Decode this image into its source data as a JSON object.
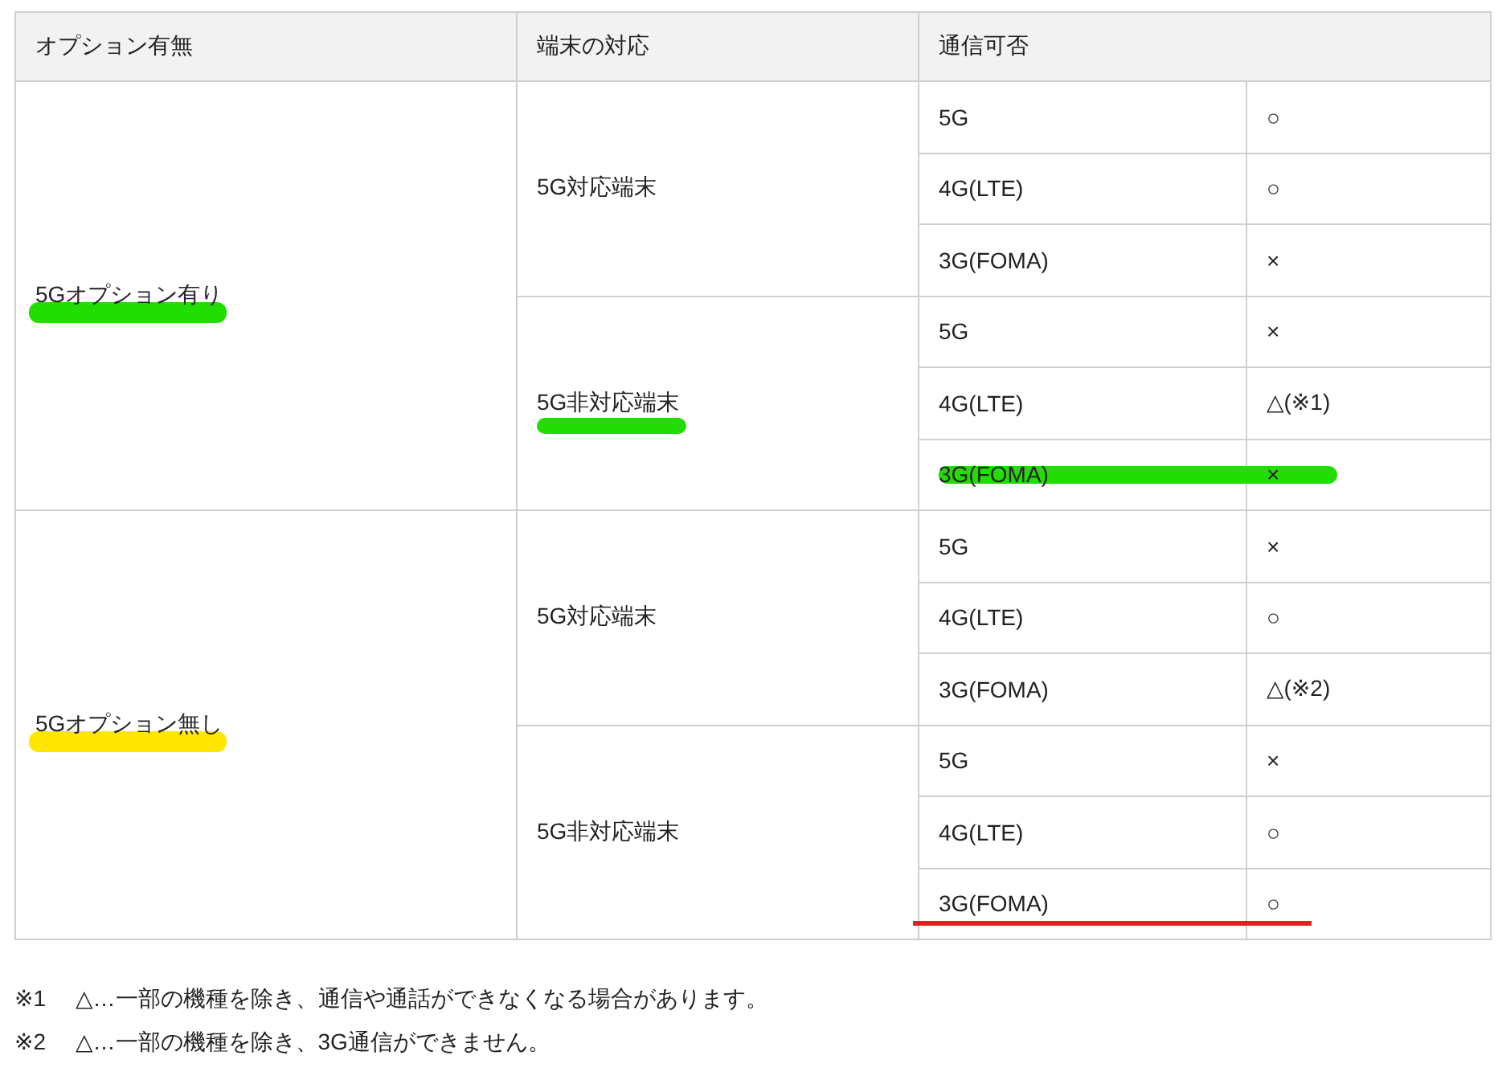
{
  "table": {
    "columns": [
      "オプション有無",
      "端末の対応",
      "通信可否"
    ],
    "groups": [
      {
        "option": "5Gオプション有り",
        "mark": {
          "kind": "highlight",
          "color": "#22dd00"
        },
        "devices": [
          {
            "label": "5G対応端末",
            "rows": [
              {
                "network": "5G",
                "availability": "○"
              },
              {
                "network": "4G(LTE)",
                "availability": "○"
              },
              {
                "network": "3G(FOMA)",
                "availability": "×"
              }
            ]
          },
          {
            "label": "5G非対応端末",
            "mark": {
              "kind": "highlight",
              "color": "#22dd00"
            },
            "rows": [
              {
                "network": "5G",
                "availability": "×"
              },
              {
                "network": "4G(LTE)",
                "availability": "△(※1)"
              },
              {
                "network": "3G(FOMA)",
                "availability": "×",
                "mark": {
                  "kind": "highlight",
                  "color": "#22dd00"
                }
              }
            ]
          }
        ]
      },
      {
        "option": "5Gオプション無し",
        "mark": {
          "kind": "highlight",
          "color": "#ffe600"
        },
        "devices": [
          {
            "label": "5G対応端末",
            "rows": [
              {
                "network": "5G",
                "availability": "×"
              },
              {
                "network": "4G(LTE)",
                "availability": "○"
              },
              {
                "network": "3G(FOMA)",
                "availability": "△(※2)"
              }
            ]
          },
          {
            "label": "5G非対応端末",
            "rows": [
              {
                "network": "5G",
                "availability": "×"
              },
              {
                "network": "4G(LTE)",
                "availability": "○"
              },
              {
                "network": "3G(FOMA)",
                "availability": "○",
                "mark": {
                  "kind": "underline",
                  "color": "#dd2222"
                }
              }
            ]
          }
        ]
      }
    ]
  },
  "notes": [
    {
      "marker": "※1",
      "text": "△…一部の機種を除き、通信や通話ができなくなる場合があります。"
    },
    {
      "marker": "※2",
      "text": "△…一部の機種を除き、3G通信ができません。"
    }
  ]
}
